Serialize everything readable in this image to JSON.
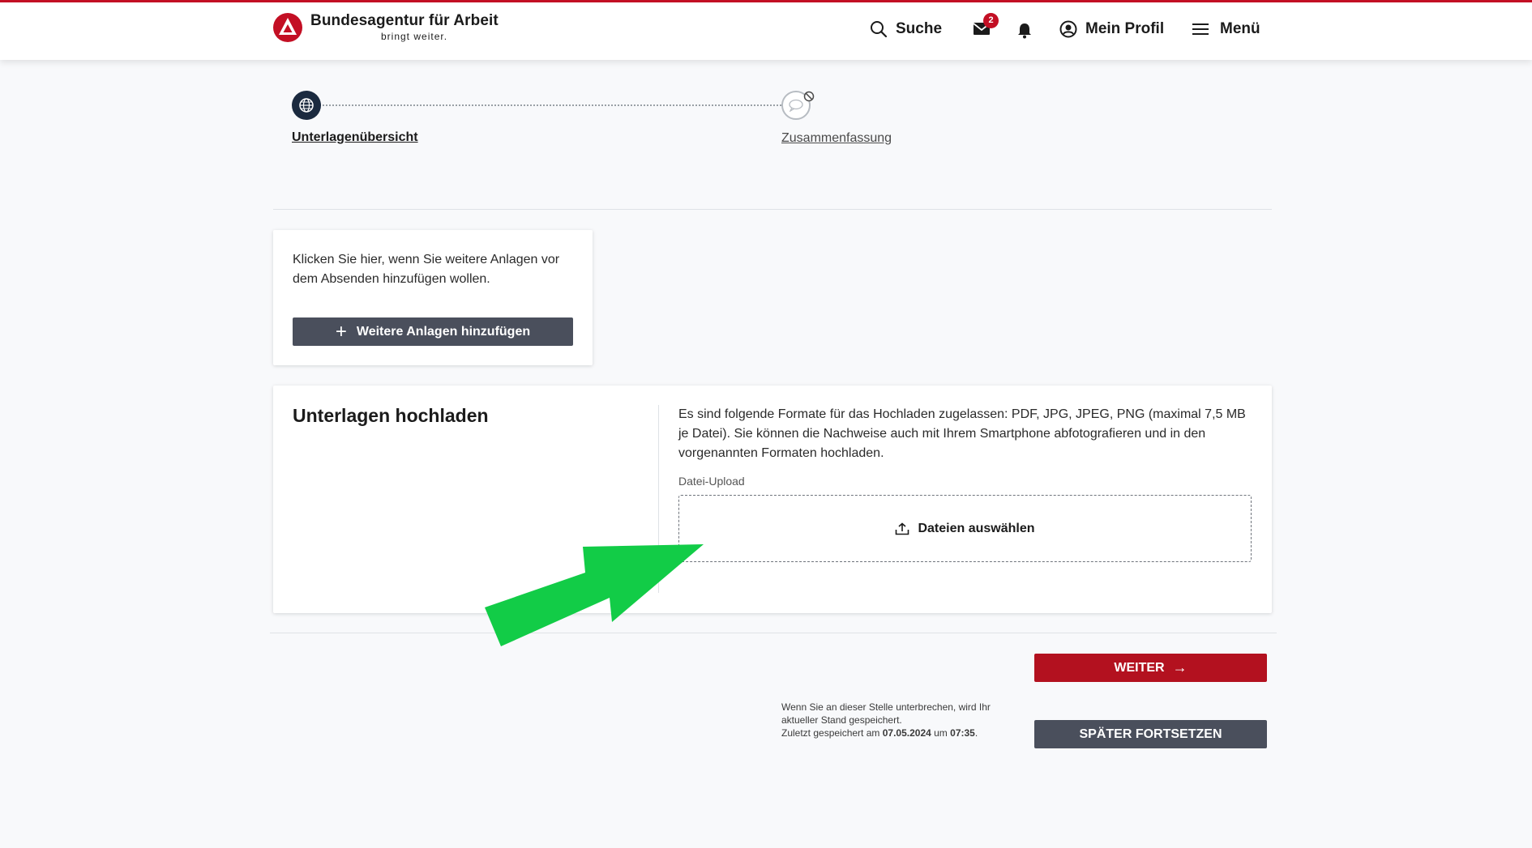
{
  "header": {
    "logo_title": "Bundesagentur für Arbeit",
    "logo_claim": "bringt weiter.",
    "search_label": "Suche",
    "mail_badge_count": "2",
    "profile_label": "Mein Profil",
    "menu_label": "Menü",
    "brand_color": "#c30f24"
  },
  "stepper": {
    "steps": [
      {
        "label": "Unterlagenübersicht",
        "state": "active",
        "icon": "globe-icon"
      },
      {
        "label": "Zusammenfassung",
        "state": "disabled",
        "icon": "chat-bubble-icon"
      }
    ]
  },
  "add_card": {
    "text": "Klicken Sie hier, wenn Sie weitere Anlagen vor dem Absenden hinzufügen wollen.",
    "button_label": "Weitere Anlagen hinzufügen"
  },
  "upload_card": {
    "title": "Unterlagen hochladen",
    "info": "Es sind folgende Formate für das Hochladen zugelassen: PDF, JPG, JPEG, PNG (maximal 7,5 MB je Datei). Sie können die Nachweise auch mit Ihrem Smartphone abfotografieren und in den vorgenannten Formaten hochladen.",
    "field_label": "Datei-Upload",
    "dropzone_label": "Dateien auswählen"
  },
  "actions": {
    "next_label": "WEITER",
    "later_label": "SPÄTER FORTSETZEN",
    "save_note_line1": "Wenn Sie an dieser Stelle unterbrechen, wird Ihr aktueller Stand gespeichert.",
    "save_note_prefix": "Zuletzt gespeichert am ",
    "save_date": "07.05.2024",
    "save_mid": " um ",
    "save_time": "07:35",
    "save_suffix": ".",
    "next_color": "#b3111f",
    "secondary_color": "#4a4f5c"
  },
  "annotation": {
    "arrow_color": "#12cc47"
  }
}
